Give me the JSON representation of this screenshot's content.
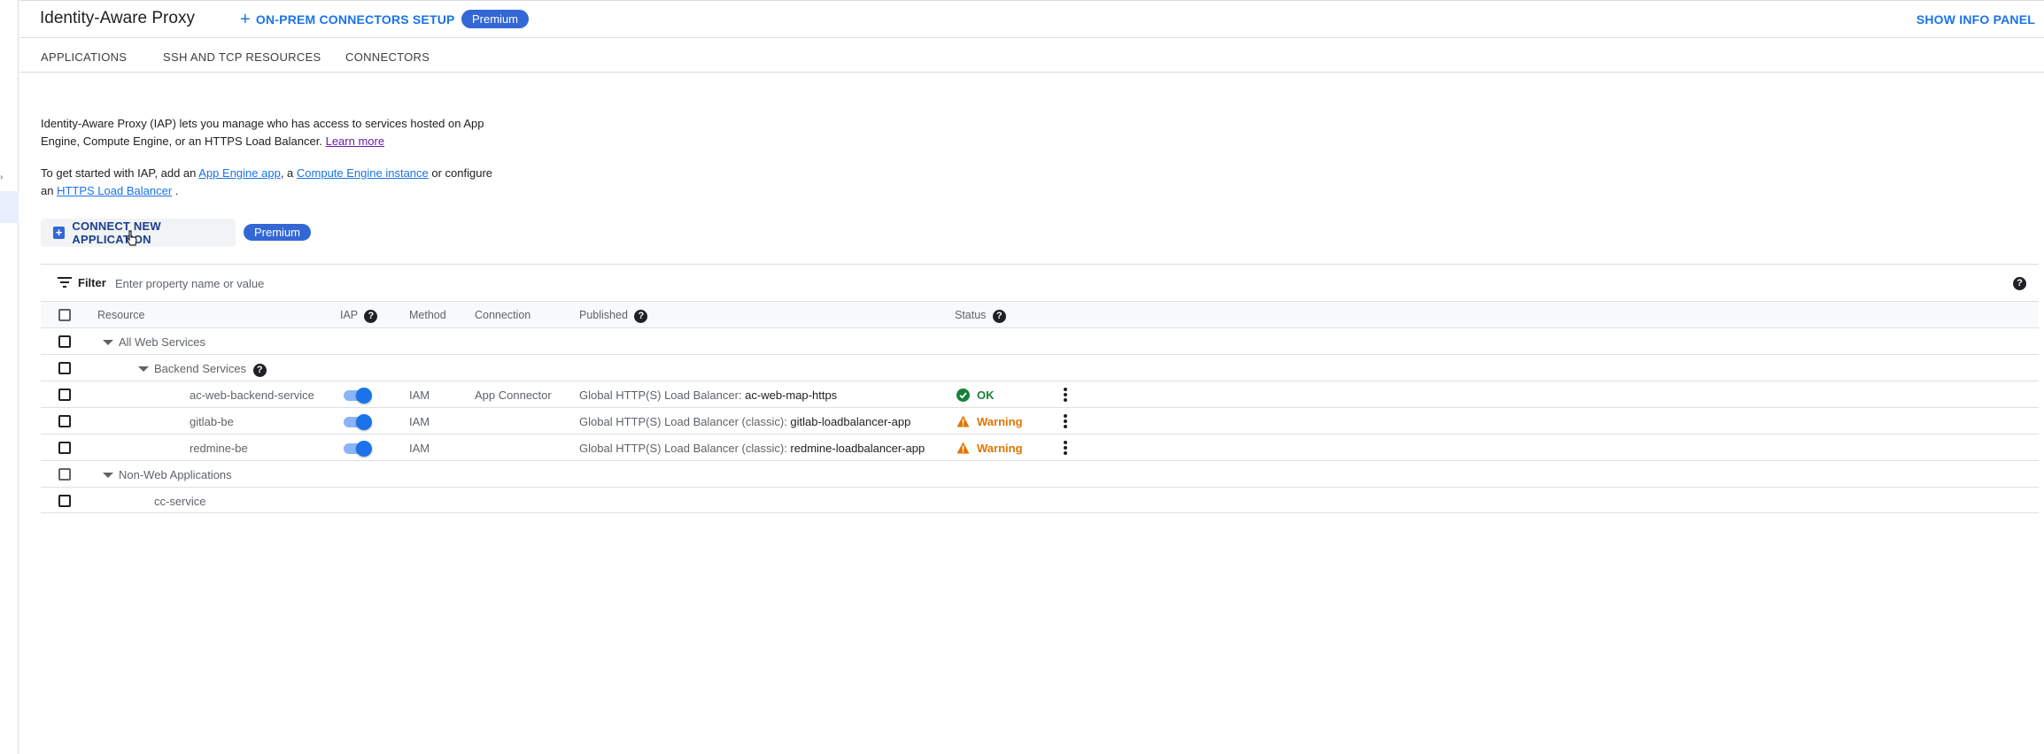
{
  "header": {
    "title": "Identity-Aware Proxy",
    "onprem_link": "ON-PREM CONNECTORS SETUP",
    "premium_badge": "Premium",
    "info_panel": "SHOW INFO PANEL"
  },
  "tabs": [
    {
      "label": "APPLICATIONS"
    },
    {
      "label": "SSH AND TCP RESOURCES"
    },
    {
      "label": "CONNECTORS"
    }
  ],
  "intro": {
    "p1_text": "Identity-Aware Proxy (IAP) lets you manage who has access to services hosted on App Engine, Compute Engine, or an HTTPS Load Balancer. ",
    "learn_more": "Learn more",
    "p2_a": "To get started with IAP, add an ",
    "app_engine_link": "App Engine app",
    "p2_b": ", a ",
    "compute_link": "Compute Engine instance",
    "p2_c": " or configure an ",
    "https_lb_link": "HTTPS Load Balancer",
    "p2_d": " ."
  },
  "actions": {
    "connect_label": "CONNECT NEW APPLICATION",
    "premium_badge": "Premium"
  },
  "filter": {
    "label": "Filter",
    "placeholder": "Enter property name or value"
  },
  "table": {
    "columns": {
      "resource": "Resource",
      "iap": "IAP",
      "method": "Method",
      "connection": "Connection",
      "published": "Published",
      "status": "Status"
    },
    "groups": {
      "all_web": "All Web Services",
      "backend": "Backend Services",
      "non_web": "Non-Web Applications"
    },
    "rows": [
      {
        "resource": "ac-web-backend-service",
        "method": "IAM",
        "connection": "App Connector",
        "published_prefix": "Global HTTP(S) Load Balancer: ",
        "published_value": "ac-web-map-https",
        "status": "OK"
      },
      {
        "resource": "gitlab-be",
        "method": "IAM",
        "connection": "",
        "published_prefix": "Global HTTP(S) Load Balancer (classic): ",
        "published_value": "gitlab-loadbalancer-app",
        "status": "Warning"
      },
      {
        "resource": "redmine-be",
        "method": "IAM",
        "connection": "",
        "published_prefix": "Global HTTP(S) Load Balancer (classic): ",
        "published_value": "redmine-loadbalancer-app",
        "status": "Warning"
      }
    ],
    "non_web_rows": [
      {
        "resource": "cc-service"
      }
    ]
  },
  "colors": {
    "primary": "#1a73e8",
    "premium": "#3367d6",
    "ok": "#188038",
    "warning": "#e37400"
  }
}
